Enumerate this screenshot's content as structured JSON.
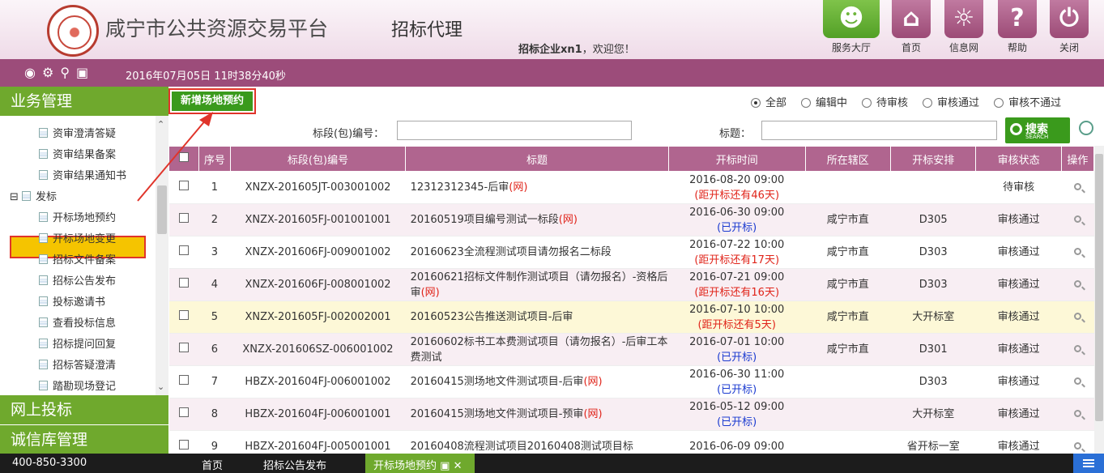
{
  "header": {
    "site_title": "咸宁市公共资源交易平台",
    "subtitle": "招标代理",
    "welcome_user": "招标企业xn1",
    "welcome_suffix": "，欢迎您！",
    "buttons": [
      {
        "label": "服务大厅",
        "icon": "service-hall-icon"
      },
      {
        "label": "首页",
        "icon": "home-icon"
      },
      {
        "label": "信息网",
        "icon": "globe-icon"
      },
      {
        "label": "帮助",
        "icon": "help-icon"
      },
      {
        "label": "关闭",
        "icon": "power-icon"
      }
    ]
  },
  "toolbar": {
    "datetime": "2016年07月05日 11时38分40秒"
  },
  "sidebar": {
    "section1": "业务管理",
    "section2": "网上投标",
    "section3": "诚信库管理",
    "items": [
      "资审澄清答疑",
      "资审结果备案",
      "资审结果通知书",
      "发标",
      "开标场地预约",
      "开标场地变更",
      "招标文件备案",
      "招标公告发布",
      "投标邀请书",
      "查看投标信息",
      "招标提问回复",
      "招标答疑澄清",
      "踏勘现场登记"
    ]
  },
  "main": {
    "add_button": "新增场地预约",
    "filters": [
      "全部",
      "编辑中",
      "待审核",
      "审核通过",
      "审核不通过"
    ],
    "label_code": "标段(包)编号：",
    "label_title": "标题：",
    "search_label": "搜索",
    "search_sub": "SEARCH",
    "columns": [
      "序号",
      "标段(包)编号",
      "标题",
      "开标时间",
      "所在辖区",
      "开标安排",
      "审核状态",
      "操作"
    ],
    "rows": [
      {
        "no": "1",
        "code": "XNZX-201605JT-003001002",
        "title": "12312312345-后审",
        "tag": "(网)",
        "time": "2016-08-20 09:00",
        "note": "(距开标还有46天)",
        "note_color": "red",
        "area": "",
        "place": "",
        "status": "待审核"
      },
      {
        "no": "2",
        "code": "XNZX-201605FJ-001001001",
        "title": "20160519项目编号测试一标段",
        "tag": "(网)",
        "time": "2016-06-30 09:00",
        "note": "(已开标)",
        "note_color": "blue",
        "area": "咸宁市直",
        "place": "D305",
        "status": "审核通过"
      },
      {
        "no": "3",
        "code": "XNZX-201606FJ-009001002",
        "title": "20160623全流程测试项目请勿报名二标段",
        "tag": "",
        "time": "2016-07-22 10:00",
        "note": "(距开标还有17天)",
        "note_color": "red",
        "area": "咸宁市直",
        "place": "D303",
        "status": "审核通过"
      },
      {
        "no": "4",
        "code": "XNZX-201606FJ-008001002",
        "title": "20160621招标文件制作测试项目（请勿报名）-资格后审",
        "tag": "(网)",
        "time": "2016-07-21 09:00",
        "note": "(距开标还有16天)",
        "note_color": "red",
        "area": "咸宁市直",
        "place": "D303",
        "status": "审核通过"
      },
      {
        "no": "5",
        "code": "XNZX-201605FJ-002002001",
        "title": "20160523公告推送测试项目-后审",
        "tag": "",
        "time": "2016-07-10 10:00",
        "note": "(距开标还有5天)",
        "note_color": "red",
        "area": "咸宁市直",
        "place": "大开标室",
        "status": "审核通过"
      },
      {
        "no": "6",
        "code": "XNZX-201606SZ-006001002",
        "title": "20160602标书工本费测试项目（请勿报名）-后审工本费测试",
        "tag": "",
        "time": "2016-07-01 10:00",
        "note": "(已开标)",
        "note_color": "blue",
        "area": "咸宁市直",
        "place": "D301",
        "status": "审核通过"
      },
      {
        "no": "7",
        "code": "HBZX-201604FJ-006001002",
        "title": "20160415测场地文件测试项目-后审",
        "tag": "(网)",
        "time": "2016-06-30 11:00",
        "note": "(已开标)",
        "note_color": "blue",
        "area": "",
        "place": "D303",
        "status": "审核通过"
      },
      {
        "no": "8",
        "code": "HBZX-201604FJ-006001001",
        "title": "20160415测场地文件测试项目-预审",
        "tag": "(网)",
        "time": "2016-05-12 09:00",
        "note": "(已开标)",
        "note_color": "blue",
        "area": "",
        "place": "大开标室",
        "status": "审核通过"
      },
      {
        "no": "9",
        "code": "HBZX-201604FJ-005001001",
        "title": "20160408流程测试项目20160408测试项目标",
        "tag": "",
        "time": "2016-06-09 09:00",
        "note": "",
        "note_color": "blue",
        "area": "",
        "place": "省开标一室",
        "status": "审核通过"
      }
    ]
  },
  "footer": {
    "phone": "400-850-3300",
    "tab1": "首页",
    "tab2": "招标公告发布",
    "active_tab": "开标场地预约"
  },
  "colors": {
    "header_bar": "#9c4c7a",
    "accent_green": "#6fa92d",
    "table_header": "#b0658f",
    "highlight": "#e0342a"
  }
}
